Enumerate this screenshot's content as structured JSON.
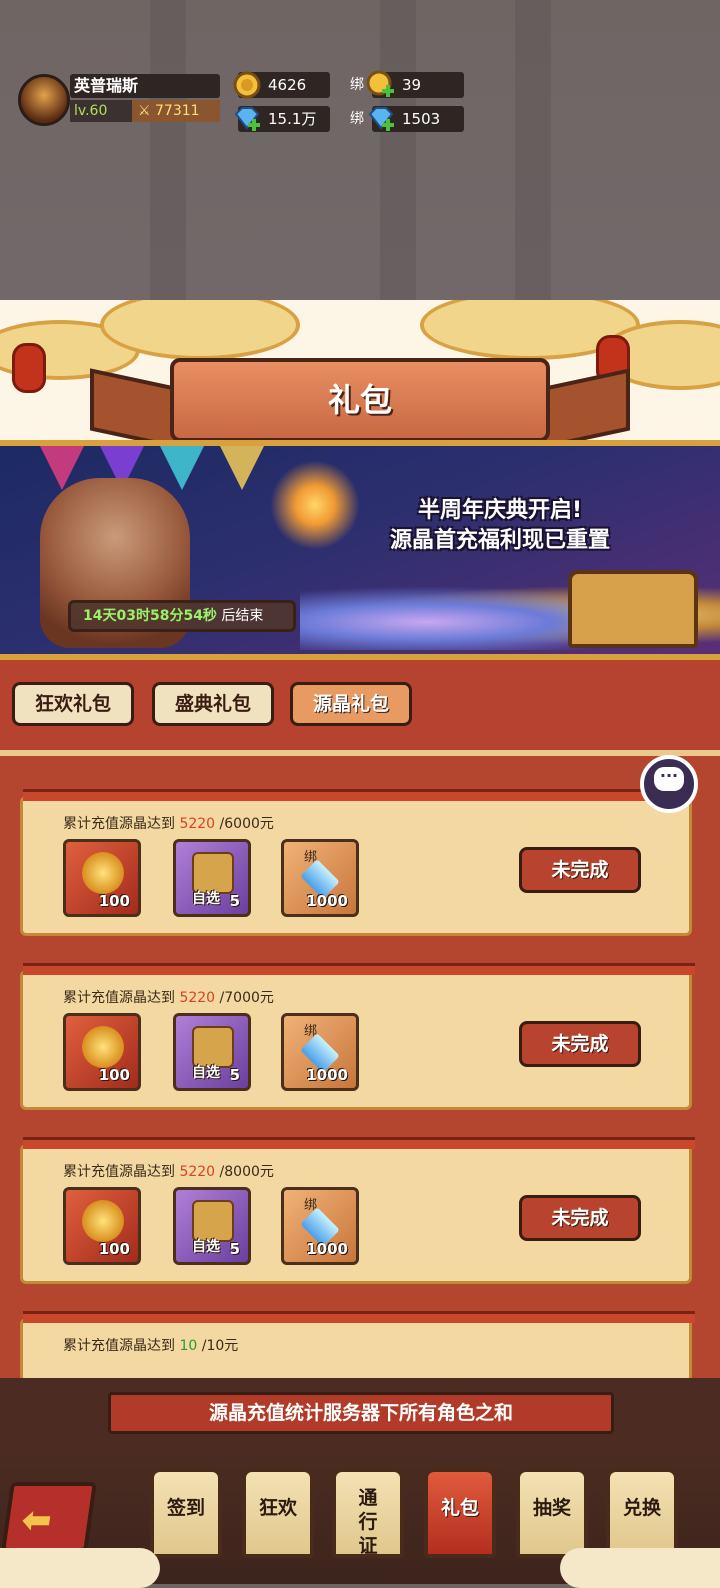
{
  "player": {
    "name": "英普瑞斯",
    "level": "lv.60",
    "power": "77311"
  },
  "resources": {
    "gold": "4626",
    "bound_gold_prefix": "绑",
    "bound_gold": "39",
    "diamond": "15.1万",
    "bound_diamond_prefix": "绑",
    "bound_diamond": "1503"
  },
  "page_title": "礼包",
  "hero": {
    "line1": "半周年庆典开启!",
    "line2": "源晶首充福利现已重置",
    "timer_value": "14天03时58分54秒",
    "timer_suffix": " 后结束"
  },
  "tabs": [
    {
      "label": "狂欢礼包",
      "active": false
    },
    {
      "label": "盛典礼包",
      "active": false
    },
    {
      "label": "源晶礼包",
      "active": true
    }
  ],
  "rows": [
    {
      "prefix": "累计充值源晶达到 ",
      "current": "5220",
      "target": " /6000元",
      "items": {
        "gold": "100",
        "box_sub": "自选",
        "box_cnt": "5",
        "dia_lock": "绑",
        "dia_cnt": "1000"
      },
      "status": "未完成"
    },
    {
      "prefix": "累计充值源晶达到 ",
      "current": "5220",
      "target": " /7000元",
      "items": {
        "gold": "100",
        "box_sub": "自选",
        "box_cnt": "5",
        "dia_lock": "绑",
        "dia_cnt": "1000"
      },
      "status": "未完成"
    },
    {
      "prefix": "累计充值源晶达到 ",
      "current": "5220",
      "target": " /8000元",
      "items": {
        "gold": "100",
        "box_sub": "自选",
        "box_cnt": "5",
        "dia_lock": "绑",
        "dia_cnt": "1000"
      },
      "status": "未完成"
    },
    {
      "prefix": "累计充值源晶达到 ",
      "current": "10",
      "target": " /10元"
    }
  ],
  "notice": "源晶充值统计服务器下所有角色之和",
  "nav": [
    {
      "label": "签到"
    },
    {
      "label": "狂欢"
    },
    {
      "label": "通行证"
    },
    {
      "label": "礼包"
    },
    {
      "label": "抽奖"
    },
    {
      "label": "兑换"
    }
  ],
  "colors": {
    "accent": "#b8432e",
    "progress_red": "#d94127",
    "progress_green": "#2c9a2c"
  }
}
